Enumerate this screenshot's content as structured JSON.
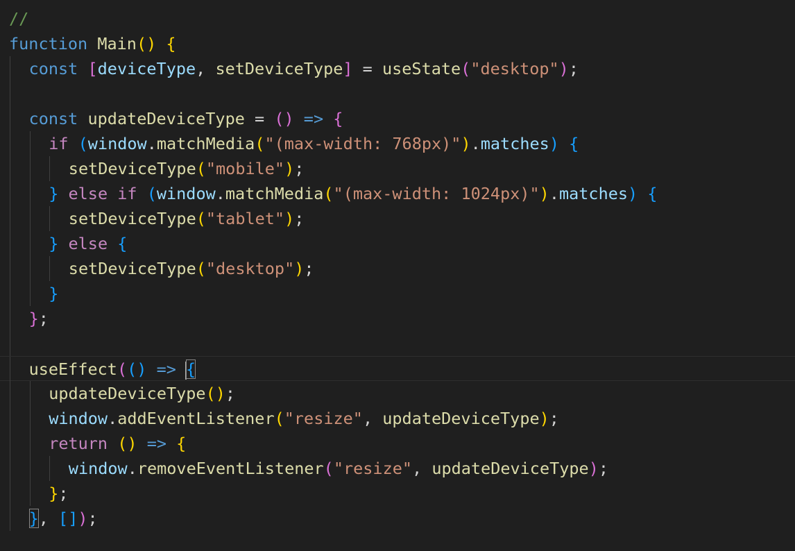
{
  "editor": {
    "language": "javascript",
    "theme": "dark",
    "colors": {
      "background": "#1f1f1f",
      "comment": "#6a9955",
      "keyword": "#569cd6",
      "control_keyword": "#c586c0",
      "function": "#dcdcaa",
      "variable": "#9cdcfe",
      "string": "#ce9178",
      "punctuation": "#d4d4d4",
      "bracket_level_1": "#ffd700",
      "bracket_level_2": "#da70d6",
      "bracket_level_3": "#179fff"
    },
    "lines": [
      {
        "indent": 0,
        "tokens": [
          {
            "t": "//",
            "c": "com"
          }
        ]
      },
      {
        "indent": 0,
        "tokens": [
          {
            "t": "function",
            "c": "kw"
          },
          {
            "t": " "
          },
          {
            "t": "Main",
            "c": "fn"
          },
          {
            "t": "(",
            "c": "b1"
          },
          {
            "t": ")",
            "c": "b1"
          },
          {
            "t": " "
          },
          {
            "t": "{",
            "c": "b1"
          }
        ]
      },
      {
        "indent": 1,
        "tokens": [
          {
            "t": "const",
            "c": "kw"
          },
          {
            "t": " "
          },
          {
            "t": "[",
            "c": "b2"
          },
          {
            "t": "deviceType",
            "c": "var"
          },
          {
            "t": ", "
          },
          {
            "t": "setDeviceType",
            "c": "fn"
          },
          {
            "t": "]",
            "c": "b2"
          },
          {
            "t": " = "
          },
          {
            "t": "useState",
            "c": "fn"
          },
          {
            "t": "(",
            "c": "b2"
          },
          {
            "t": "\"desktop\"",
            "c": "str"
          },
          {
            "t": ")",
            "c": "b2"
          },
          {
            "t": ";"
          }
        ]
      },
      {
        "indent": 1,
        "tokens": []
      },
      {
        "indent": 1,
        "tokens": [
          {
            "t": "const",
            "c": "kw"
          },
          {
            "t": " "
          },
          {
            "t": "updateDeviceType",
            "c": "fn"
          },
          {
            "t": " = "
          },
          {
            "t": "(",
            "c": "b2"
          },
          {
            "t": ")",
            "c": "b2"
          },
          {
            "t": " "
          },
          {
            "t": "=>",
            "c": "kw"
          },
          {
            "t": " "
          },
          {
            "t": "{",
            "c": "b2"
          }
        ]
      },
      {
        "indent": 2,
        "tokens": [
          {
            "t": "if",
            "c": "ctl"
          },
          {
            "t": " "
          },
          {
            "t": "(",
            "c": "b3"
          },
          {
            "t": "window",
            "c": "var"
          },
          {
            "t": "."
          },
          {
            "t": "matchMedia",
            "c": "fn"
          },
          {
            "t": "(",
            "c": "b1"
          },
          {
            "t": "\"(max-width: 768px)\"",
            "c": "str"
          },
          {
            "t": ")",
            "c": "b1"
          },
          {
            "t": "."
          },
          {
            "t": "matches",
            "c": "var"
          },
          {
            "t": ")",
            "c": "b3"
          },
          {
            "t": " "
          },
          {
            "t": "{",
            "c": "b3"
          }
        ]
      },
      {
        "indent": 3,
        "tokens": [
          {
            "t": "setDeviceType",
            "c": "fn"
          },
          {
            "t": "(",
            "c": "b1"
          },
          {
            "t": "\"mobile\"",
            "c": "str"
          },
          {
            "t": ")",
            "c": "b1"
          },
          {
            "t": ";"
          }
        ]
      },
      {
        "indent": 2,
        "tokens": [
          {
            "t": "}",
            "c": "b3"
          },
          {
            "t": " "
          },
          {
            "t": "else",
            "c": "ctl"
          },
          {
            "t": " "
          },
          {
            "t": "if",
            "c": "ctl"
          },
          {
            "t": " "
          },
          {
            "t": "(",
            "c": "b3"
          },
          {
            "t": "window",
            "c": "var"
          },
          {
            "t": "."
          },
          {
            "t": "matchMedia",
            "c": "fn"
          },
          {
            "t": "(",
            "c": "b1"
          },
          {
            "t": "\"(max-width: 1024px)\"",
            "c": "str"
          },
          {
            "t": ")",
            "c": "b1"
          },
          {
            "t": "."
          },
          {
            "t": "matches",
            "c": "var"
          },
          {
            "t": ")",
            "c": "b3"
          },
          {
            "t": " "
          },
          {
            "t": "{",
            "c": "b3"
          }
        ]
      },
      {
        "indent": 3,
        "tokens": [
          {
            "t": "setDeviceType",
            "c": "fn"
          },
          {
            "t": "(",
            "c": "b1"
          },
          {
            "t": "\"tablet\"",
            "c": "str"
          },
          {
            "t": ")",
            "c": "b1"
          },
          {
            "t": ";"
          }
        ]
      },
      {
        "indent": 2,
        "tokens": [
          {
            "t": "}",
            "c": "b3"
          },
          {
            "t": " "
          },
          {
            "t": "else",
            "c": "ctl"
          },
          {
            "t": " "
          },
          {
            "t": "{",
            "c": "b3"
          }
        ]
      },
      {
        "indent": 3,
        "tokens": [
          {
            "t": "setDeviceType",
            "c": "fn"
          },
          {
            "t": "(",
            "c": "b1"
          },
          {
            "t": "\"desktop\"",
            "c": "str"
          },
          {
            "t": ")",
            "c": "b1"
          },
          {
            "t": ";"
          }
        ]
      },
      {
        "indent": 2,
        "tokens": [
          {
            "t": "}",
            "c": "b3"
          }
        ]
      },
      {
        "indent": 1,
        "tokens": [
          {
            "t": "}",
            "c": "b2"
          },
          {
            "t": ";"
          }
        ]
      },
      {
        "indent": 1,
        "tokens": []
      },
      {
        "indent": 1,
        "current": true,
        "tokens": [
          {
            "t": "useEffect",
            "c": "fn"
          },
          {
            "t": "(",
            "c": "b2"
          },
          {
            "t": "(",
            "c": "b3"
          },
          {
            "t": ")",
            "c": "b3"
          },
          {
            "t": " "
          },
          {
            "t": "=>",
            "c": "kw"
          },
          {
            "t": " "
          },
          {
            "t": "{",
            "c": "b3",
            "match": true,
            "cursor": "before"
          }
        ]
      },
      {
        "indent": 2,
        "tokens": [
          {
            "t": "updateDeviceType",
            "c": "fn"
          },
          {
            "t": "(",
            "c": "b1"
          },
          {
            "t": ")",
            "c": "b1"
          },
          {
            "t": ";"
          }
        ]
      },
      {
        "indent": 2,
        "tokens": [
          {
            "t": "window",
            "c": "var"
          },
          {
            "t": "."
          },
          {
            "t": "addEventListener",
            "c": "fn"
          },
          {
            "t": "(",
            "c": "b1"
          },
          {
            "t": "\"resize\"",
            "c": "str"
          },
          {
            "t": ", "
          },
          {
            "t": "updateDeviceType",
            "c": "fn"
          },
          {
            "t": ")",
            "c": "b1"
          },
          {
            "t": ";"
          }
        ]
      },
      {
        "indent": 2,
        "tokens": [
          {
            "t": "return",
            "c": "ctl"
          },
          {
            "t": " "
          },
          {
            "t": "(",
            "c": "b1"
          },
          {
            "t": ")",
            "c": "b1"
          },
          {
            "t": " "
          },
          {
            "t": "=>",
            "c": "kw"
          },
          {
            "t": " "
          },
          {
            "t": "{",
            "c": "b1"
          }
        ]
      },
      {
        "indent": 3,
        "tokens": [
          {
            "t": "window",
            "c": "var"
          },
          {
            "t": "."
          },
          {
            "t": "removeEventListener",
            "c": "fn"
          },
          {
            "t": "(",
            "c": "b2"
          },
          {
            "t": "\"resize\"",
            "c": "str"
          },
          {
            "t": ", "
          },
          {
            "t": "updateDeviceType",
            "c": "fn"
          },
          {
            "t": ")",
            "c": "b2"
          },
          {
            "t": ";"
          }
        ]
      },
      {
        "indent": 2,
        "tokens": [
          {
            "t": "}",
            "c": "b1"
          },
          {
            "t": ";"
          }
        ]
      },
      {
        "indent": 1,
        "tokens": [
          {
            "t": "}",
            "c": "b3",
            "match": true
          },
          {
            "t": ", "
          },
          {
            "t": "[",
            "c": "b3"
          },
          {
            "t": "]",
            "c": "b3"
          },
          {
            "t": ")",
            "c": "b2"
          },
          {
            "t": ";"
          }
        ]
      }
    ]
  }
}
